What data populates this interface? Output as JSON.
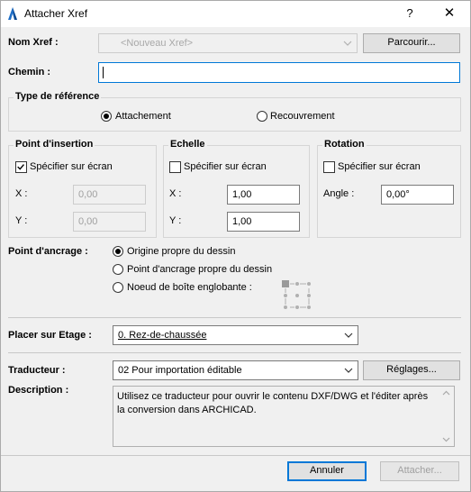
{
  "window": {
    "title": "Attacher Xref",
    "help_label": "?",
    "close_label": "✕"
  },
  "xref": {
    "name_label": "Nom Xref :",
    "name_placeholder": "<Nouveau Xref>",
    "browse_label": "Parcourir...",
    "path_label": "Chemin :",
    "path_value": ""
  },
  "reference_type": {
    "title": "Type de référence",
    "options": [
      {
        "label": "Attachement",
        "selected": true
      },
      {
        "label": "Recouvrement",
        "selected": false
      }
    ]
  },
  "insertion": {
    "title": "Point d'insertion",
    "specify_label": "Spécifier sur écran",
    "specify_checked": true,
    "x_label": "X :",
    "x_value": "0,00",
    "y_label": "Y :",
    "y_value": "0,00"
  },
  "scale": {
    "title": "Echelle",
    "specify_label": "Spécifier sur écran",
    "specify_checked": false,
    "x_label": "X :",
    "x_value": "1,00",
    "y_label": "Y :",
    "y_value": "1,00"
  },
  "rotation": {
    "title": "Rotation",
    "specify_label": "Spécifier sur écran",
    "specify_checked": false,
    "angle_label": "Angle :",
    "angle_value": "0,00°"
  },
  "anchor": {
    "label": "Point d'ancrage :",
    "options": [
      {
        "label": "Origine propre du dessin",
        "selected": true
      },
      {
        "label": "Point d'ancrage propre du dessin",
        "selected": false
      },
      {
        "label": "Noeud de boîte englobante :",
        "selected": false
      }
    ]
  },
  "story": {
    "label": "Placer sur Etage :",
    "value": "0. Rez-de-chaussée"
  },
  "translator": {
    "label": "Traducteur :",
    "value": "02 Pour importation éditable",
    "settings_label": "Réglages...",
    "description_label": "Description :",
    "description": "Utilisez ce traducteur pour ouvrir le contenu DXF/DWG et l'éditer après la conversion dans ARCHICAD."
  },
  "footer": {
    "cancel_label": "Annuler",
    "attach_label": "Attacher..."
  },
  "colors": {
    "accent": "#0078d7",
    "window_bg": "#f0f0f0"
  }
}
